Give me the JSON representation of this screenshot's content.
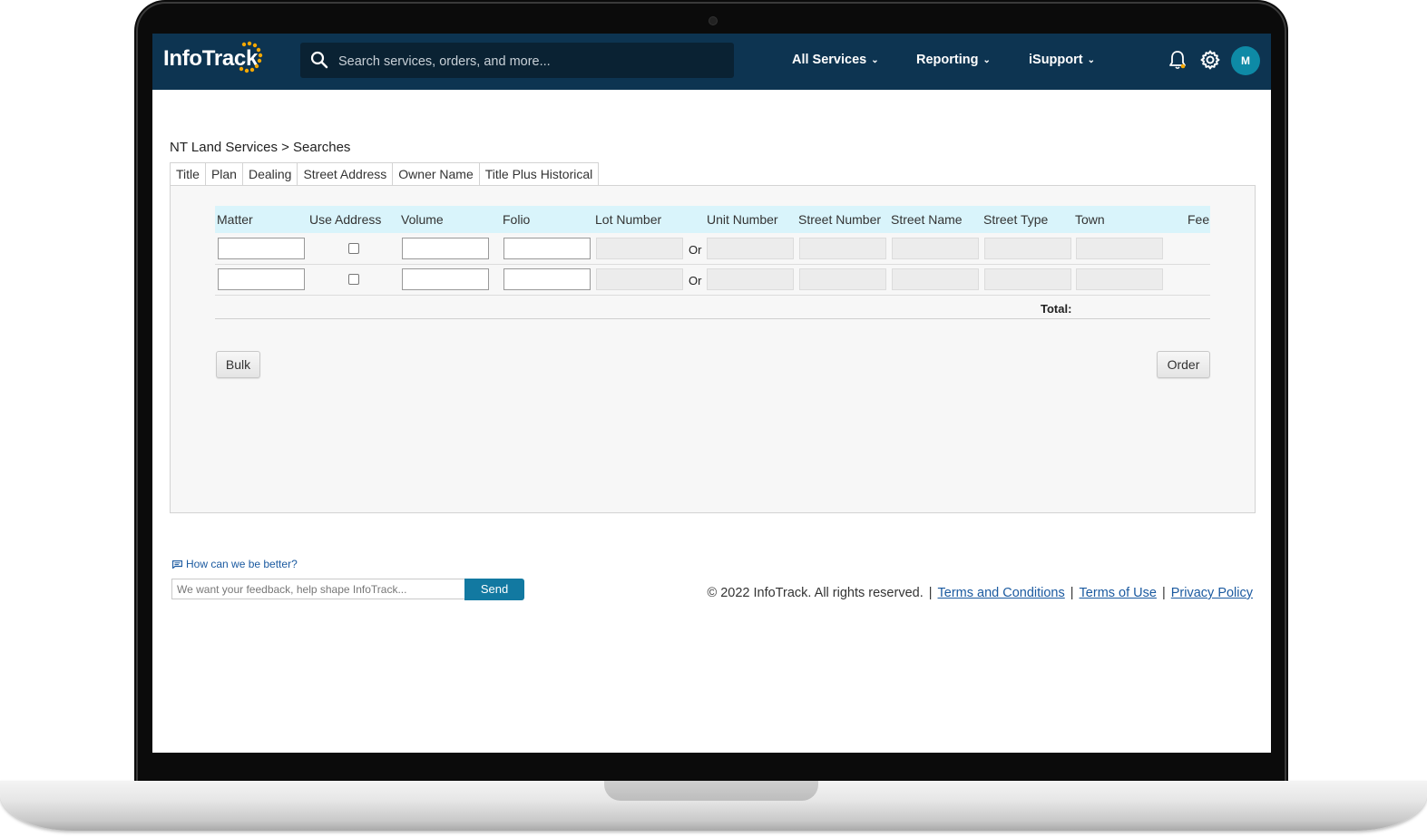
{
  "nav": {
    "logo_text": "InfoTrack",
    "search_placeholder": "Search services, orders, and more...",
    "items": [
      {
        "label": "All Services"
      },
      {
        "label": "Reporting"
      },
      {
        "label": "iSupport"
      }
    ],
    "avatar_initial": "M",
    "logo_color": "#f7a800",
    "bar_color": "#0d3451"
  },
  "breadcrumb": "NT Land Services > Searches",
  "tabs": [
    {
      "label": "Title",
      "active": true
    },
    {
      "label": "Plan"
    },
    {
      "label": "Dealing"
    },
    {
      "label": "Street Address"
    },
    {
      "label": "Owner Name"
    },
    {
      "label": "Title Plus Historical"
    }
  ],
  "table": {
    "headers": [
      "Matter",
      "Use Address",
      "Volume",
      "Folio",
      "Lot Number",
      "Unit Number",
      "Street Number",
      "Street Name",
      "Street Type",
      "Town",
      "Fee"
    ],
    "rows": [
      {
        "matter": "",
        "use_address": false,
        "volume": "",
        "folio": "",
        "or_label": "Or"
      },
      {
        "matter": "",
        "use_address": false,
        "volume": "",
        "folio": "",
        "or_label": "Or"
      }
    ],
    "total_label": "Total:"
  },
  "buttons": {
    "bulk": "Bulk",
    "order": "Order"
  },
  "feedback": {
    "link": "How can we be better?",
    "placeholder": "We want your feedback, help shape InfoTrack...",
    "send": "Send"
  },
  "footer": {
    "copyright": "© 2022 InfoTrack. All rights reserved.",
    "links": [
      "Terms and Conditions",
      "Terms of Use",
      "Privacy Policy"
    ]
  }
}
